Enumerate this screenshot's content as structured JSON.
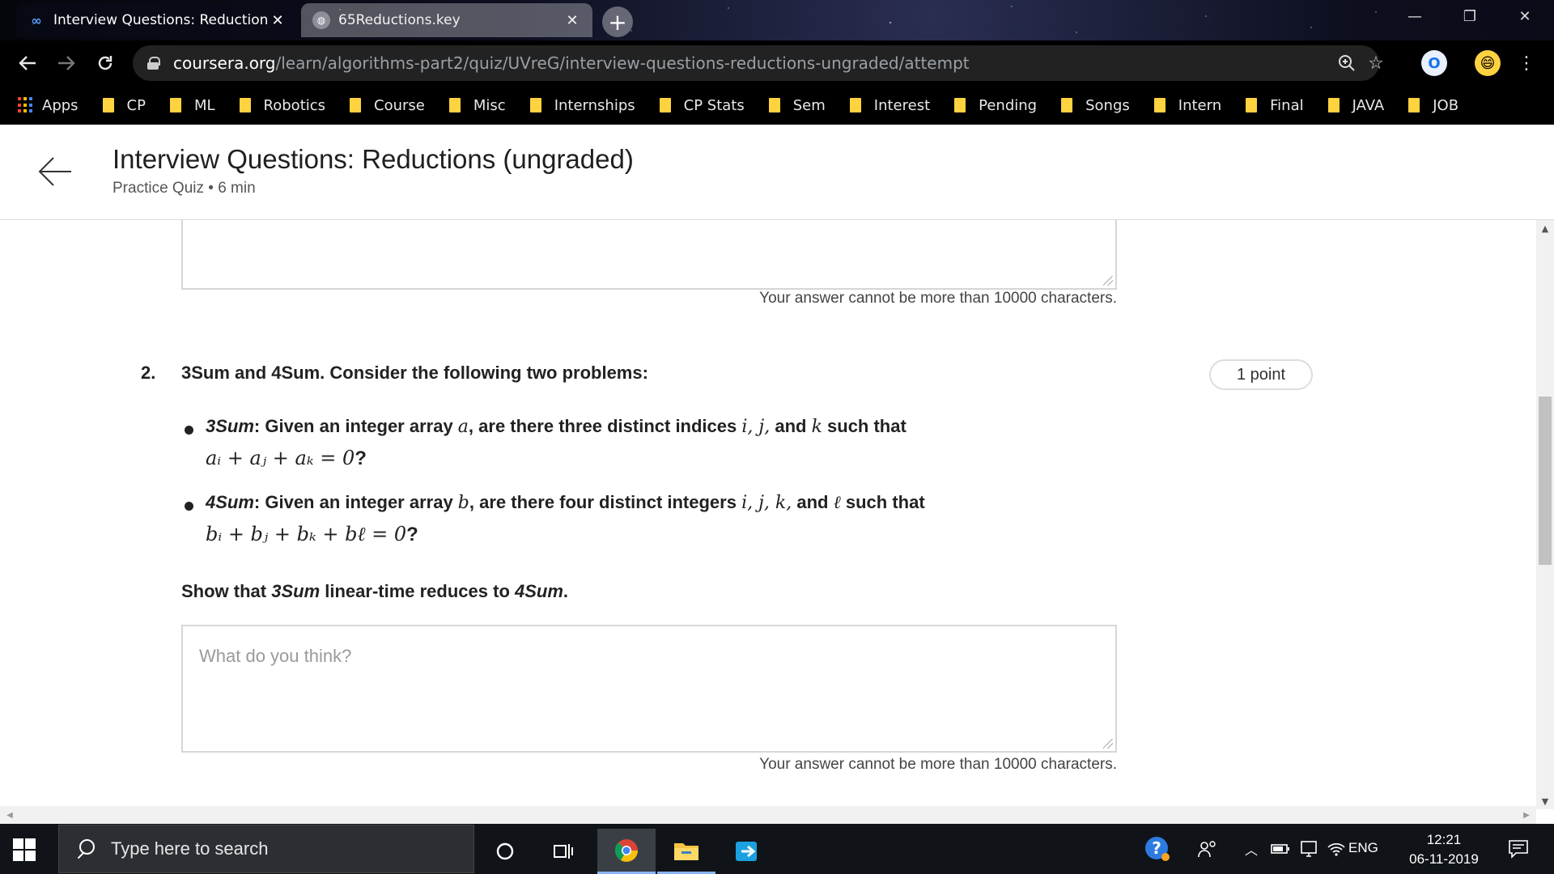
{
  "browser": {
    "tabs": [
      {
        "title": "Interview Questions: Reductions (",
        "close": "✕",
        "favicon": "coursera-icon"
      },
      {
        "title": "65Reductions.key",
        "close": "✕",
        "favicon": "globe-icon"
      }
    ],
    "new_tab": "+",
    "window_controls": {
      "minimize": "—",
      "maximize": "❐",
      "close": "✕"
    },
    "address": {
      "host": "coursera.org",
      "path": "/learn/algorithms-part2/quiz/UVreG/interview-questions-reductions-ungraded/attempt"
    },
    "bookmarks": {
      "apps": "Apps",
      "folders": [
        "CP",
        "ML",
        "Robotics",
        "Course",
        "Misc",
        "Internships",
        "CP Stats",
        "Sem",
        "Interest",
        "Pending",
        "Songs",
        "Intern",
        "Final",
        "JAVA",
        "JOB"
      ]
    }
  },
  "page": {
    "title": "Interview Questions: Reductions (ungraded)",
    "subtitle": "Practice Quiz • 6 min",
    "char_limit_text": "Your answer cannot be more than 10000 characters.",
    "question": {
      "number": "2.",
      "title": "3Sum and 4Sum. Consider the following two problems:",
      "points": "1 point",
      "bullets": [
        {
          "name": "3Sum",
          "text_a": ": Given an integer array ",
          "var_a": "a",
          "text_b": ", are there three distinct indices ",
          "vars": "i, j,",
          "text_c": " and ",
          "var_k": "k",
          "text_d": " such that",
          "equation": "aᵢ + aⱼ + aₖ = 0",
          "end": "?"
        },
        {
          "name": "4Sum",
          "text_a": ": Given an integer array ",
          "var_a": "b",
          "text_b": ", are there four distinct integers ",
          "vars": "i, j, k,",
          "text_c": " and ",
          "var_k": "ℓ",
          "text_d": " such that",
          "equation": "bᵢ + bⱼ + bₖ + bℓ = 0",
          "end": "?"
        }
      ],
      "prompt_pre": "Show that ",
      "prompt_a": "3Sum",
      "prompt_mid": " linear-time reduces to ",
      "prompt_b": "4Sum",
      "prompt_end": ".",
      "answer_placeholder": "What do you think?"
    }
  },
  "taskbar": {
    "search_placeholder": "Type here to search",
    "language": "ENG",
    "time": "12:21",
    "date": "06-11-2019"
  }
}
